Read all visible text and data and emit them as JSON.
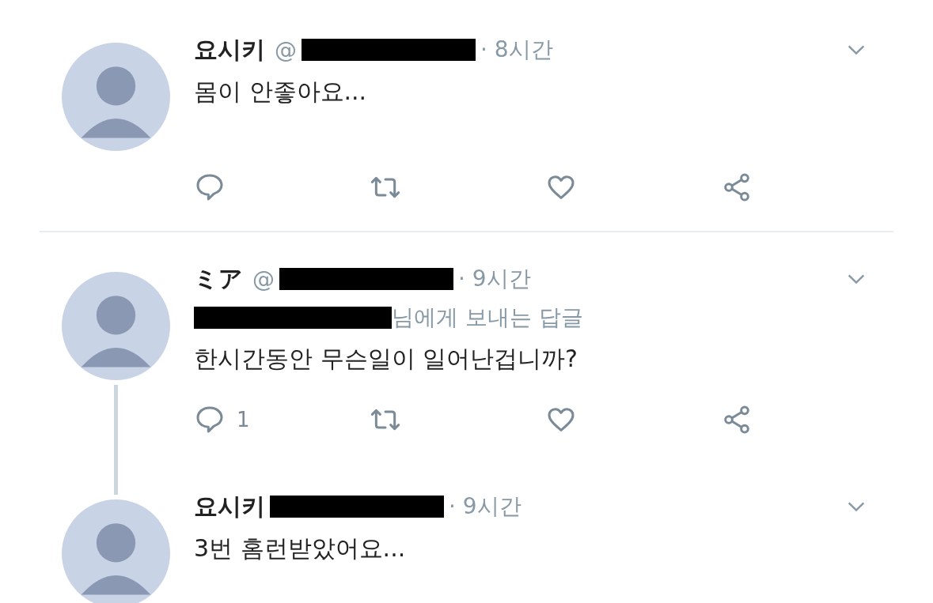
{
  "threads": [
    {
      "tweets": [
        {
          "name": "요시키",
          "handle": "@",
          "time": "· 8시간",
          "text": "몸이 안좋아요...",
          "kind": "full"
        }
      ]
    },
    {
      "tweets": [
        {
          "name": "ミア",
          "handle": "@",
          "time": "· 9시간",
          "reply_label": "님에게 보내는 답글",
          "text": "한시간동안 무슨일이 일어난겁니까?",
          "kind": "full",
          "reply_count": "1"
        },
        {
          "name": "요시키",
          "time": "· 9시간",
          "text": "3번 홈런받았어요...",
          "kind": "cropped"
        }
      ]
    }
  ]
}
